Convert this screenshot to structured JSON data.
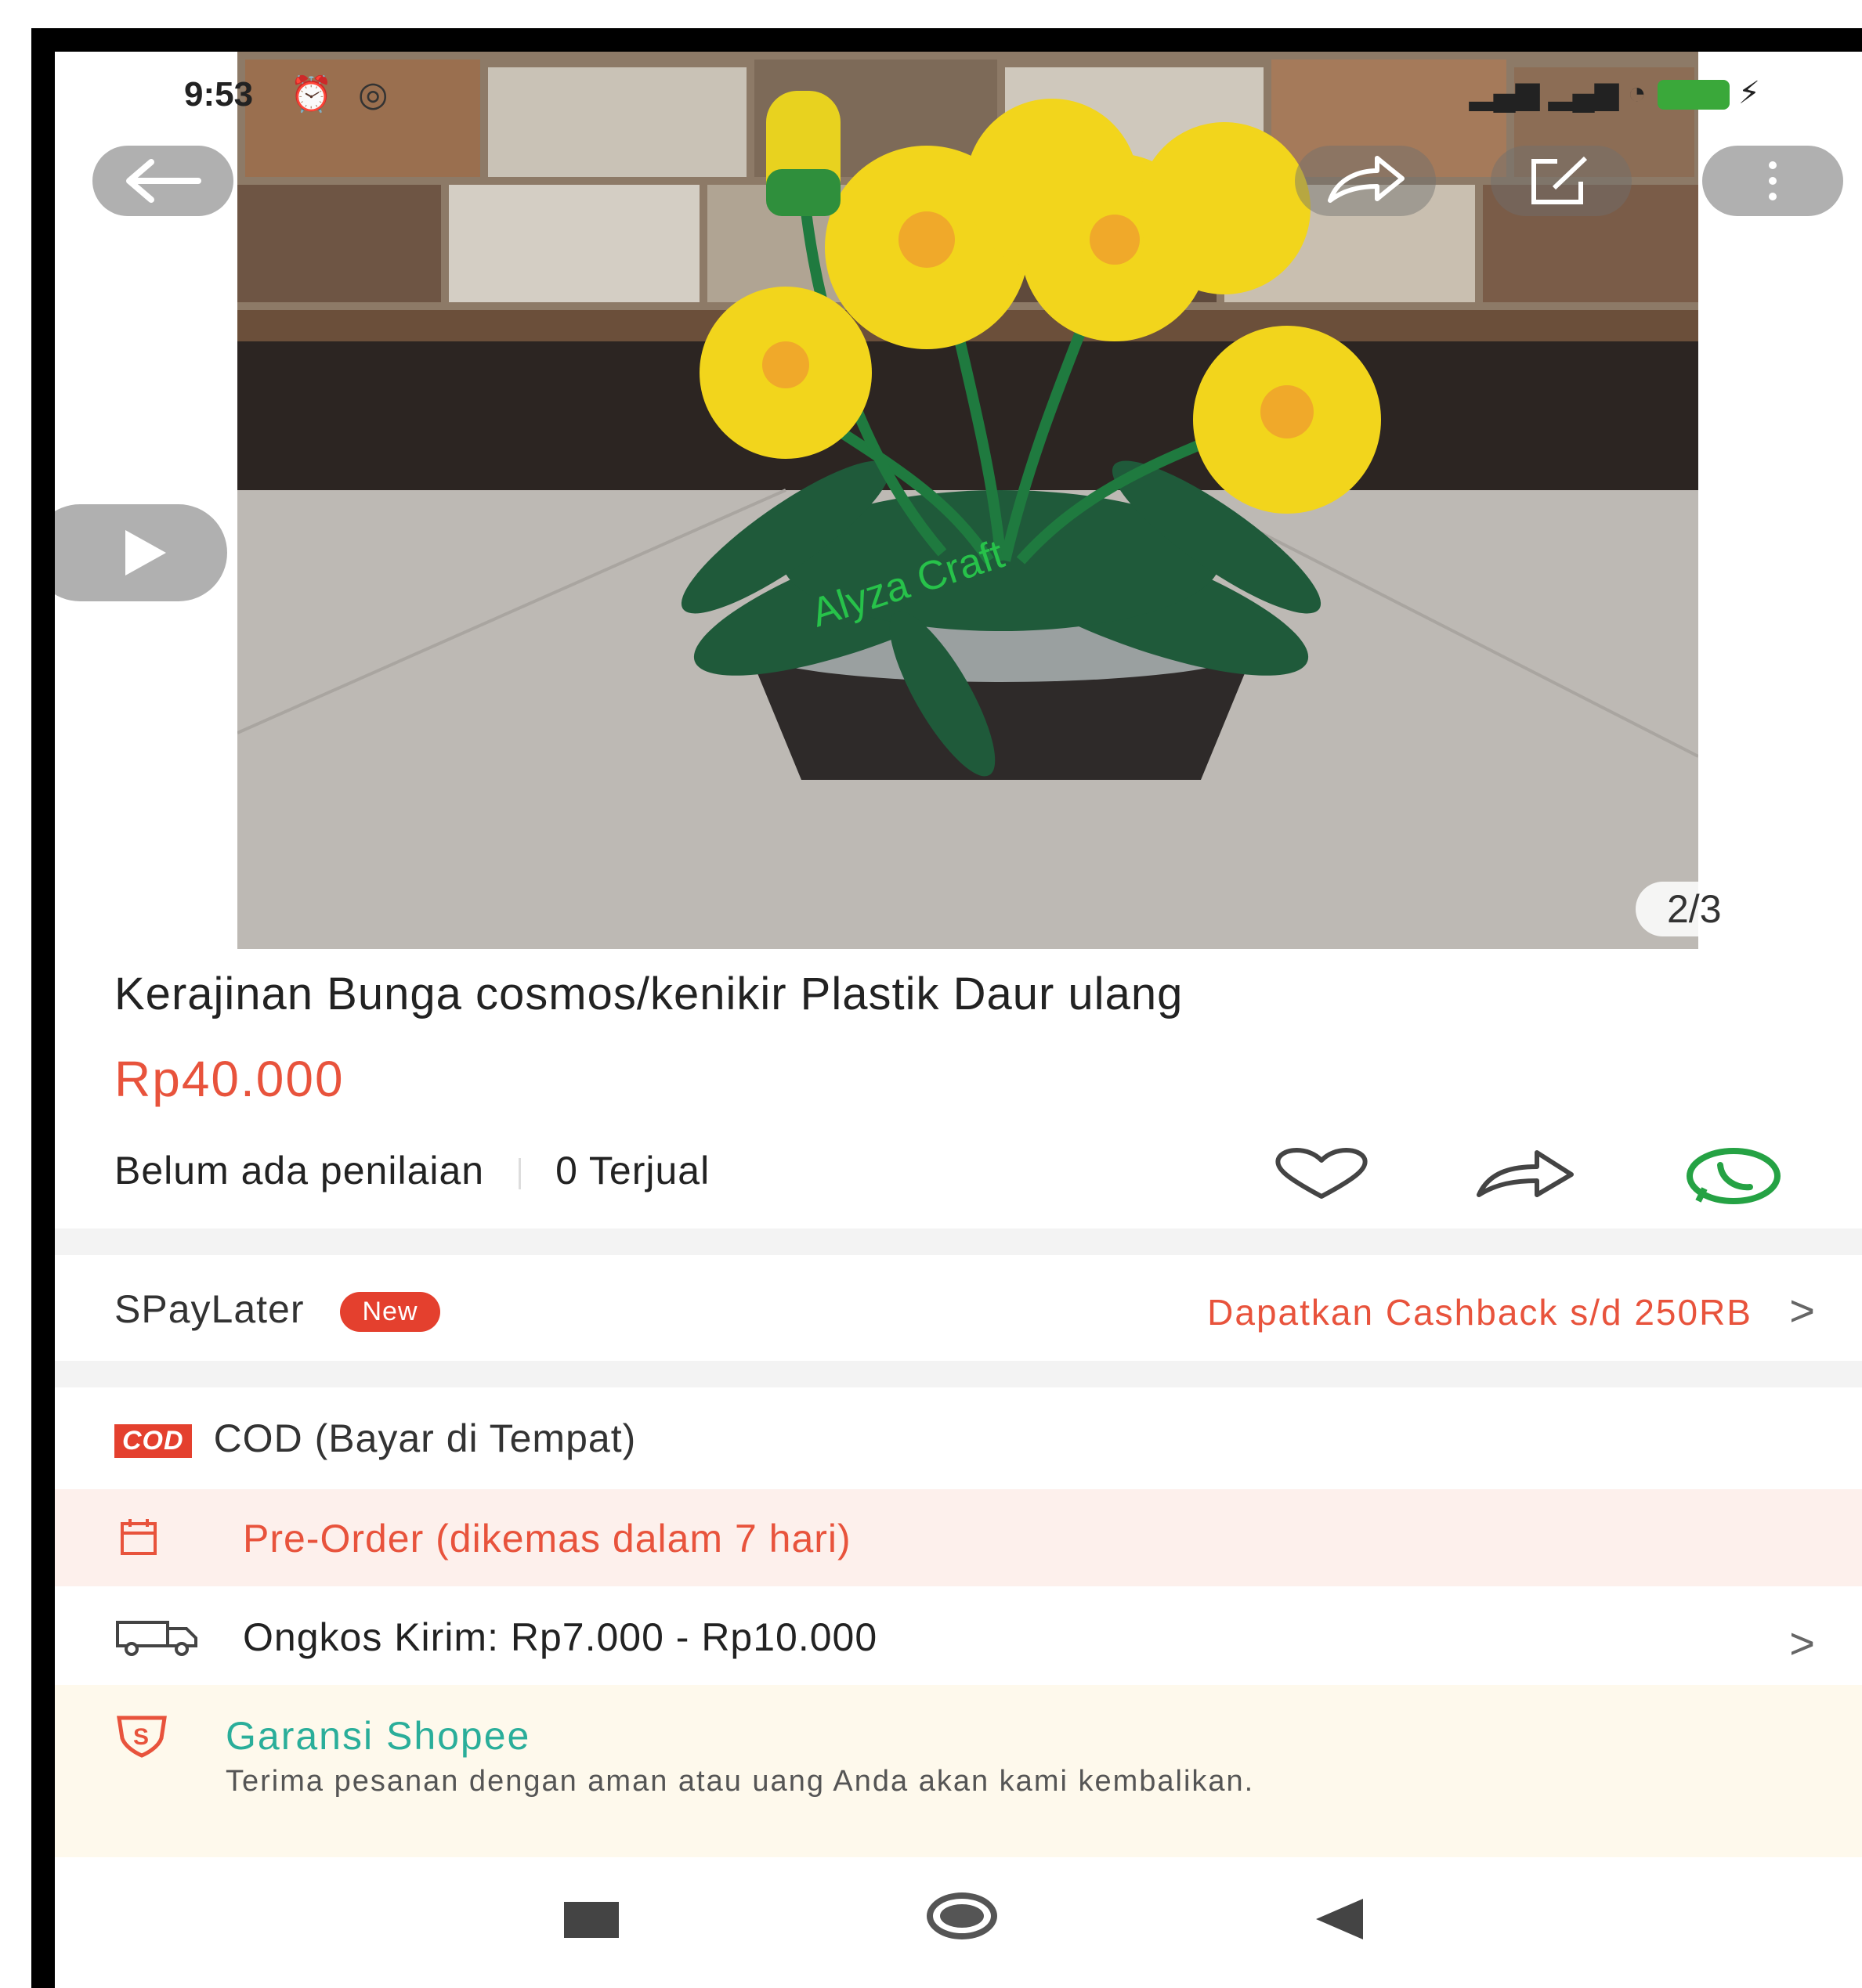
{
  "status_bar": {
    "time": "9:53"
  },
  "gallery": {
    "page_indicator": "2/3",
    "watermark": "Alyza Craft"
  },
  "product": {
    "title": "Kerajinan Bunga cosmos/kenikir Plastik Daur ulang",
    "price": "Rp40.000",
    "rating_text": "Belum ada penilaian",
    "sold_text": "0 Terjual"
  },
  "spaylater": {
    "label": "SPayLater",
    "badge": "New",
    "promo": "Dapatkan Cashback s/d 250RB",
    "chevron": ">"
  },
  "cod": {
    "tag": "COD",
    "label": "COD (Bayar di Tempat)"
  },
  "preorder": {
    "label": "Pre-Order (dikemas dalam 7 hari)"
  },
  "shipping": {
    "label": "Ongkos Kirim: Rp7.000 - Rp10.000",
    "chevron": ">"
  },
  "guarantee": {
    "title": "Garansi Shopee",
    "text": "Terima pesanan dengan aman atau uang Anda akan kami kembalikan."
  },
  "colors": {
    "accent": "#e8533c",
    "badge": "#e4402e",
    "guarantee_title": "#2aae9a",
    "whatsapp": "#25a244"
  },
  "icons": {
    "back": "arrow-left-icon",
    "share": "share-icon",
    "edit": "edit-icon",
    "more": "more-vertical-icon",
    "play": "play-icon",
    "favorite": "heart-icon",
    "whatsapp": "whatsapp-icon",
    "calendar": "calendar-icon",
    "truck": "truck-icon",
    "shield": "shield-icon"
  }
}
